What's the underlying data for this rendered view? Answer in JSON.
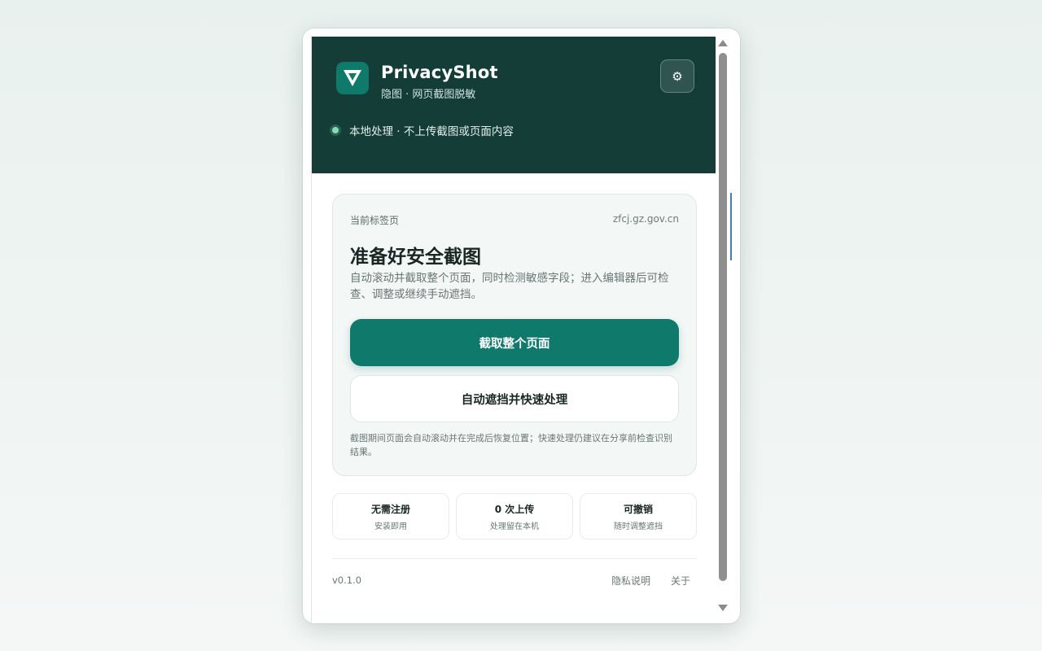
{
  "header": {
    "app_title": "PrivacyShot",
    "app_subtitle": "隐图 · 网页截图脱敏",
    "status_text": "本地处理 · 不上传截图或页面内容",
    "settings_icon": "gear-icon",
    "logo_icon": "shield-v-icon",
    "bg_color": "#143d38",
    "accent_color": "#0f7a6c"
  },
  "card": {
    "label": "当前标签页",
    "domain": "zfcj.gz.gov.cn",
    "heading": "准备好安全截图",
    "description": "自动滚动并截取整个页面，同时检测敏感字段；进入编辑器后可检查、调整或继续手动遮挡。",
    "primary_button": "截取整个页面",
    "secondary_button": "自动遮挡并快速处理",
    "note": "截图期间页面会自动滚动并在完成后恢复位置；快速处理仍建议在分享前检查识别结果。"
  },
  "features": [
    {
      "title": "无需注册",
      "subtitle": "安装即用"
    },
    {
      "title": "0 次上传",
      "subtitle": "处理留在本机"
    },
    {
      "title": "可撤销",
      "subtitle": "随时调整遮挡"
    }
  ],
  "footer": {
    "version": "v0.1.0",
    "privacy_link": "隐私说明",
    "about_link": "关于"
  }
}
